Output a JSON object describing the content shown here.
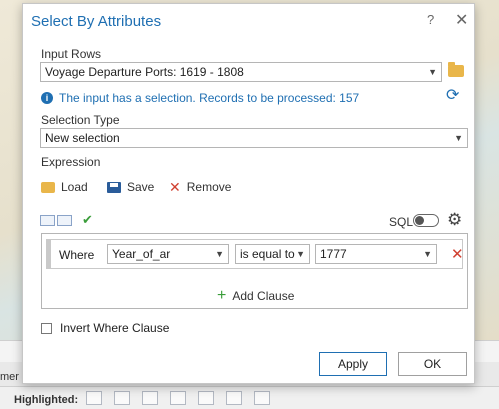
{
  "dialog": {
    "title": "Select By Attributes",
    "help_label": "?",
    "close_label": "✕"
  },
  "input_rows": {
    "label": "Input Rows",
    "value": "Voyage Departure Ports: 1619 - 1808"
  },
  "info": {
    "icon_glyph": "i",
    "message": "The input has a selection. Records to be processed: 157"
  },
  "selection_type": {
    "label": "Selection Type",
    "value": "New selection"
  },
  "expression": {
    "label": "Expression",
    "load_label": "Load",
    "save_label": "Save",
    "remove_label": "Remove",
    "sql_label": "SQL"
  },
  "clause": {
    "where_label": "Where",
    "field": "Year_of_ar",
    "operator": "is equal to",
    "value": "1777",
    "add_clause_label": "Add Clause"
  },
  "invert_label": "Invert Where Clause",
  "buttons": {
    "apply": "Apply",
    "ok": "OK"
  },
  "background": {
    "partial_text": "mer",
    "highlighted_label": "Highlighted:"
  },
  "colors": {
    "accent": "#1f6fb2",
    "remove": "#d04030",
    "add": "#3a9d3a"
  },
  "icons": [
    "folder-icon",
    "info-icon",
    "refresh-icon",
    "load-icon",
    "save-icon",
    "remove-icon",
    "check-icon",
    "gear-icon",
    "delete-clause-icon",
    "plus-icon"
  ]
}
